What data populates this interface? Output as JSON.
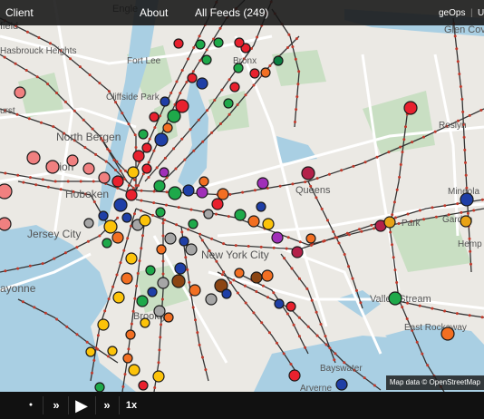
{
  "topbar": {
    "app_title": "Client",
    "about": "About",
    "all_feeds": "All Feeds (249)",
    "user": "geOps",
    "divider": "|",
    "extra": "U"
  },
  "map": {
    "labels": {
      "glen_cove": "Glen Cov",
      "hasbrouck": "Hasbrouck Heights",
      "fort_lee": "Fort Lee",
      "bronx": "Bronx",
      "cliffside": "Cliffside Park",
      "north_bergen": "North Bergen",
      "union": "Union",
      "hoboken": "Hoboken",
      "jersey_city": "Jersey City",
      "queens": "Queens",
      "new_york_city": "New York City",
      "mineola": "Mineola",
      "roslyn": "Roslyn",
      "park": "Park",
      "garden": "Garden",
      "hemp": "Hemp",
      "bayonne": "ayonne",
      "valley_stream": "Valley Stream",
      "east_rockaway": "East Rockaway",
      "brooklyn": "Brooklyn",
      "bayswater": "Bayswater",
      "arverne": "Arverne",
      "urst": "urst",
      "eld": "field",
      "engle": "Engle"
    },
    "marker_colors": {
      "red": "#e8212e",
      "orange": "#f26f22",
      "yellow": "#fcc30a",
      "green": "#1ea94a",
      "darkgreen": "#0b8042",
      "blue": "#1f3fa6",
      "purple": "#a02fb8",
      "gray": "#a6a6a6",
      "brown": "#8b4513",
      "pink": "#f08080",
      "maroon": "#b3214a",
      "gold": "#e8a317"
    }
  },
  "attribution": "Map data © OpenStreetMap",
  "player": {
    "stop": "●",
    "rewind": "»",
    "play": "▶",
    "forward": "»",
    "speed": "1x"
  }
}
